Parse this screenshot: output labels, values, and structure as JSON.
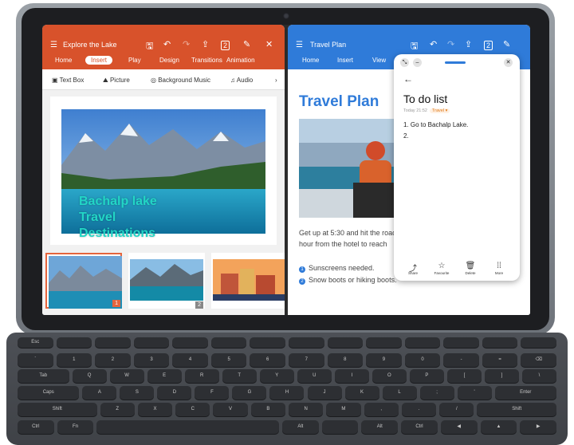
{
  "left_app": {
    "title": "Explore the Lake",
    "tabs": [
      "Home",
      "Insert",
      "Play",
      "Design",
      "Transitions",
      "Animation"
    ],
    "active_tab": "Insert",
    "toolbar_items": [
      "Text Box",
      "Picture",
      "Background Music",
      "Audio"
    ],
    "slide_text": [
      "Bachalp lake",
      "Travel",
      "Destinations"
    ],
    "thumbnails": [
      {
        "num": "1"
      },
      {
        "num": "2"
      },
      {
        "num": ""
      }
    ]
  },
  "right_app": {
    "title": "Travel Plan",
    "tabs": [
      "Home",
      "Insert",
      "View"
    ],
    "doc_title": "Travel Plan",
    "body_line1": "Get up at 5:30 and hit the road",
    "body_line2": "hour from the hotel to reach",
    "bullets": [
      "Sunscreens needed.",
      "Snow boots or hiking boots."
    ]
  },
  "note": {
    "back_arrow": "←",
    "title": "To do list",
    "meta_time": "Today 21:52",
    "meta_tag": "Travel",
    "items": [
      "1. Go to Bachalp Lake.",
      "2."
    ],
    "footer": [
      {
        "label": "Share",
        "icon": "share-icon"
      },
      {
        "label": "Favourite",
        "icon": "star-icon"
      },
      {
        "label": "Delete",
        "icon": "trash-icon"
      },
      {
        "label": "More",
        "icon": "more-icon"
      }
    ]
  },
  "keyboard": {
    "row1": [
      "Esc",
      "",
      "",
      "",
      "",
      "",
      "",
      "",
      "",
      "",
      "",
      "",
      "",
      ""
    ],
    "row2": [
      "`",
      "1",
      "2",
      "3",
      "4",
      "5",
      "6",
      "7",
      "8",
      "9",
      "0",
      "-",
      "=",
      "⌫"
    ],
    "row3": [
      "Tab",
      "Q",
      "W",
      "E",
      "R",
      "T",
      "Y",
      "U",
      "I",
      "O",
      "P",
      "[",
      "]",
      "\\"
    ],
    "row4": [
      "Caps",
      "A",
      "S",
      "D",
      "F",
      "G",
      "H",
      "J",
      "K",
      "L",
      ";",
      "'",
      "Enter"
    ],
    "row5": [
      "Shift",
      "Z",
      "X",
      "C",
      "V",
      "B",
      "N",
      "M",
      ",",
      ".",
      "/",
      "Shift"
    ],
    "row6": [
      "Ctrl",
      "Fn",
      "",
      "Alt",
      "",
      "Alt",
      "Ctrl",
      "◀",
      "▲",
      "▶"
    ]
  },
  "colors": {
    "left_accent": "#d8522b",
    "right_accent": "#2f7bd9",
    "slide_text": "#22d6c6"
  }
}
